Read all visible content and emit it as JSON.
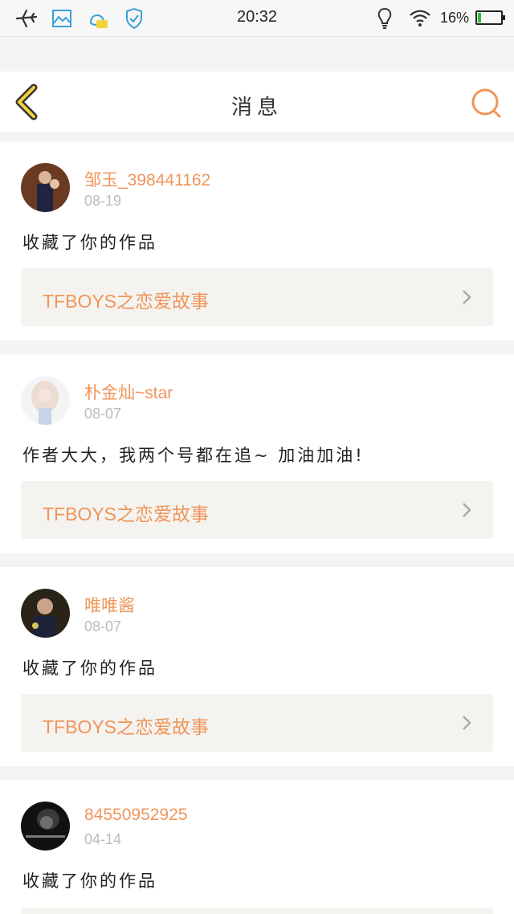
{
  "status_bar": {
    "time": "20:32",
    "battery_percent": "16%",
    "battery_level": 0.16,
    "icons": [
      "airplane-icon",
      "gallery-icon",
      "qq-icon",
      "shield-icon",
      "lightbulb-icon",
      "wifi-icon",
      "battery-icon"
    ]
  },
  "header": {
    "title": "消息",
    "back_icon": "chevron-left-icon",
    "search_icon": "search-icon",
    "accent": "#f0955a"
  },
  "messages": [
    {
      "user": "邹玉_398441162",
      "date": "08-19",
      "text": "收藏了你的作品",
      "work": "TFBOYS之恋爱故事"
    },
    {
      "user": "朴金灿~star",
      "date": "08-07",
      "text": "作者大大，我两个号都在追~ 加油加油!",
      "work": "TFBOYS之恋爱故事"
    },
    {
      "user": "唯唯酱",
      "date": "08-07",
      "text": "收藏了你的作品",
      "work": "TFBOYS之恋爱故事"
    },
    {
      "user": "84550952925",
      "date": "04-14",
      "text": "收藏了你的作品"
    }
  ]
}
